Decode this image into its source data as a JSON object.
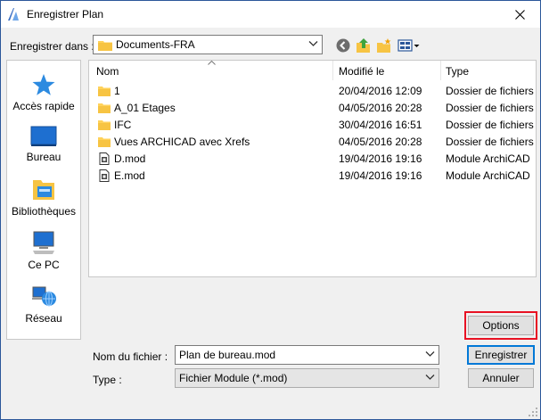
{
  "window": {
    "title": "Enregistrer Plan"
  },
  "toolbar": {
    "save_in_label": "Enregistrer dans :",
    "folder": "Documents-FRA"
  },
  "sidebar": {
    "items": [
      {
        "label": "Accès rapide",
        "icon": "star-icon"
      },
      {
        "label": "Bureau",
        "icon": "desktop-icon"
      },
      {
        "label": "Bibliothèques",
        "icon": "libraries-icon"
      },
      {
        "label": "Ce PC",
        "icon": "computer-icon"
      },
      {
        "label": "Réseau",
        "icon": "network-icon"
      }
    ]
  },
  "files": {
    "columns": [
      "Nom",
      "Modifié le",
      "Type"
    ],
    "rows": [
      {
        "name": "1",
        "date": "20/04/2016 12:09",
        "type": "Dossier de fichiers",
        "kind": "folder"
      },
      {
        "name": "A_01 Etages",
        "date": "04/05/2016 20:28",
        "type": "Dossier de fichiers",
        "kind": "folder"
      },
      {
        "name": "IFC",
        "date": "30/04/2016 16:51",
        "type": "Dossier de fichiers",
        "kind": "folder"
      },
      {
        "name": "Vues ARCHICAD avec Xrefs",
        "date": "04/05/2016 20:28",
        "type": "Dossier de fichiers",
        "kind": "folder"
      },
      {
        "name": "D.mod",
        "date": "19/04/2016 19:16",
        "type": "Module ArchiCAD",
        "kind": "module"
      },
      {
        "name": "E.mod",
        "date": "19/04/2016 19:16",
        "type": "Module ArchiCAD",
        "kind": "module"
      }
    ]
  },
  "form": {
    "filename_label": "Nom du fichier :",
    "filename_value": "Plan de bureau.mod",
    "type_label": "Type :",
    "type_value": "Fichier Module (*.mod)"
  },
  "buttons": {
    "options": "Options",
    "save": "Enregistrer",
    "cancel": "Annuler"
  },
  "colors": {
    "accent": "#0078d7",
    "highlight": "#e81123",
    "folder": "#ffd25a"
  }
}
